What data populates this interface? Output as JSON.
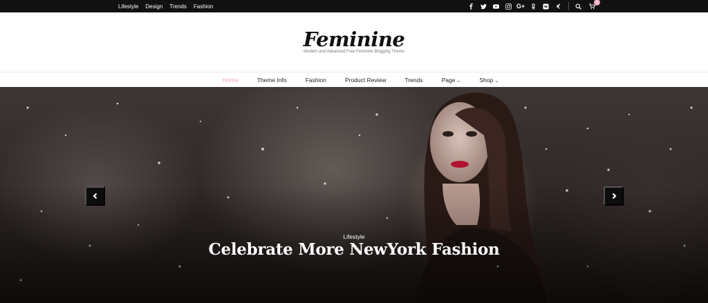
{
  "topbar": {
    "nav": [
      "Lifestyle",
      "Design",
      "Trends",
      "Fashion"
    ],
    "social_icons": [
      "facebook-icon",
      "twitter-icon",
      "youtube-icon",
      "instagram-icon",
      "google-plus-icon",
      "odnoklassniki-icon",
      "vk-icon",
      "xing-icon"
    ],
    "cart_count": "0"
  },
  "header": {
    "title": "Feminine",
    "tagline": "Modern and Advanced Free Feminine Blogging Theme"
  },
  "mainnav": {
    "items": [
      {
        "label": "Home"
      },
      {
        "label": "Theme Info"
      },
      {
        "label": "Fashion"
      },
      {
        "label": "Product Review"
      },
      {
        "label": "Trends"
      },
      {
        "label": "Page"
      },
      {
        "label": "Shop"
      }
    ]
  },
  "slider": {
    "category": "Lifestyle",
    "title": "Celebrate More NewYork Fashion"
  },
  "colors": {
    "accent": "#f4a3be",
    "topbar_bg": "#111111"
  }
}
